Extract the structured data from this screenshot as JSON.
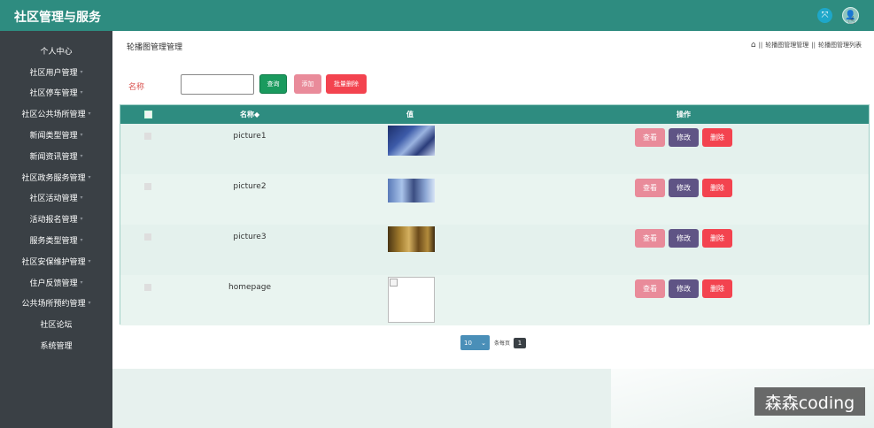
{
  "app": {
    "title": "社区管理与服务"
  },
  "topbar": {
    "fullscreen_icon": "fullscreen-icon",
    "avatar_icon": "user-avatar-icon"
  },
  "sidebar": {
    "items": [
      {
        "label": "个人中心",
        "has_arrow": false
      },
      {
        "label": "社区用户管理",
        "has_arrow": true
      },
      {
        "label": "社区停车管理",
        "has_arrow": true
      },
      {
        "label": "社区公共场所管理",
        "has_arrow": true
      },
      {
        "label": "新闻类型管理",
        "has_arrow": true
      },
      {
        "label": "新闻资讯管理",
        "has_arrow": true
      },
      {
        "label": "社区政务服务管理",
        "has_arrow": true
      },
      {
        "label": "社区活动管理",
        "has_arrow": true
      },
      {
        "label": "活动报名管理",
        "has_arrow": true
      },
      {
        "label": "服务类型管理",
        "has_arrow": true
      },
      {
        "label": "社区安保维护管理",
        "has_arrow": true
      },
      {
        "label": "住户反馈管理",
        "has_arrow": true
      },
      {
        "label": "公共场所预约管理",
        "has_arrow": true
      },
      {
        "label": "社区论坛",
        "has_arrow": false
      },
      {
        "label": "系统管理",
        "has_arrow": false
      }
    ]
  },
  "page": {
    "title": "轮播图管理管理",
    "breadcrumb": {
      "sep": "||",
      "item1": "轮播图管理管理",
      "item2": "轮播图管理列表"
    }
  },
  "search": {
    "label": "名称",
    "value": "",
    "query_label": "查询",
    "add_label": "添加",
    "batch_delete_label": "批量删除"
  },
  "table": {
    "headers": {
      "name": "名称◆",
      "value": "值",
      "actions": "操作"
    },
    "rows": [
      {
        "name": "picture1",
        "image": "thumb1"
      },
      {
        "name": "picture2",
        "image": "thumb2"
      },
      {
        "name": "picture3",
        "image": "thumb3"
      },
      {
        "name": "homepage",
        "image": "broken"
      }
    ],
    "view_label": "查看",
    "edit_label": "修改",
    "delete_label": "删除"
  },
  "pagination": {
    "page_size": "10",
    "total_text": "条每页",
    "current_page": "1"
  },
  "watermark": "森森coding"
}
